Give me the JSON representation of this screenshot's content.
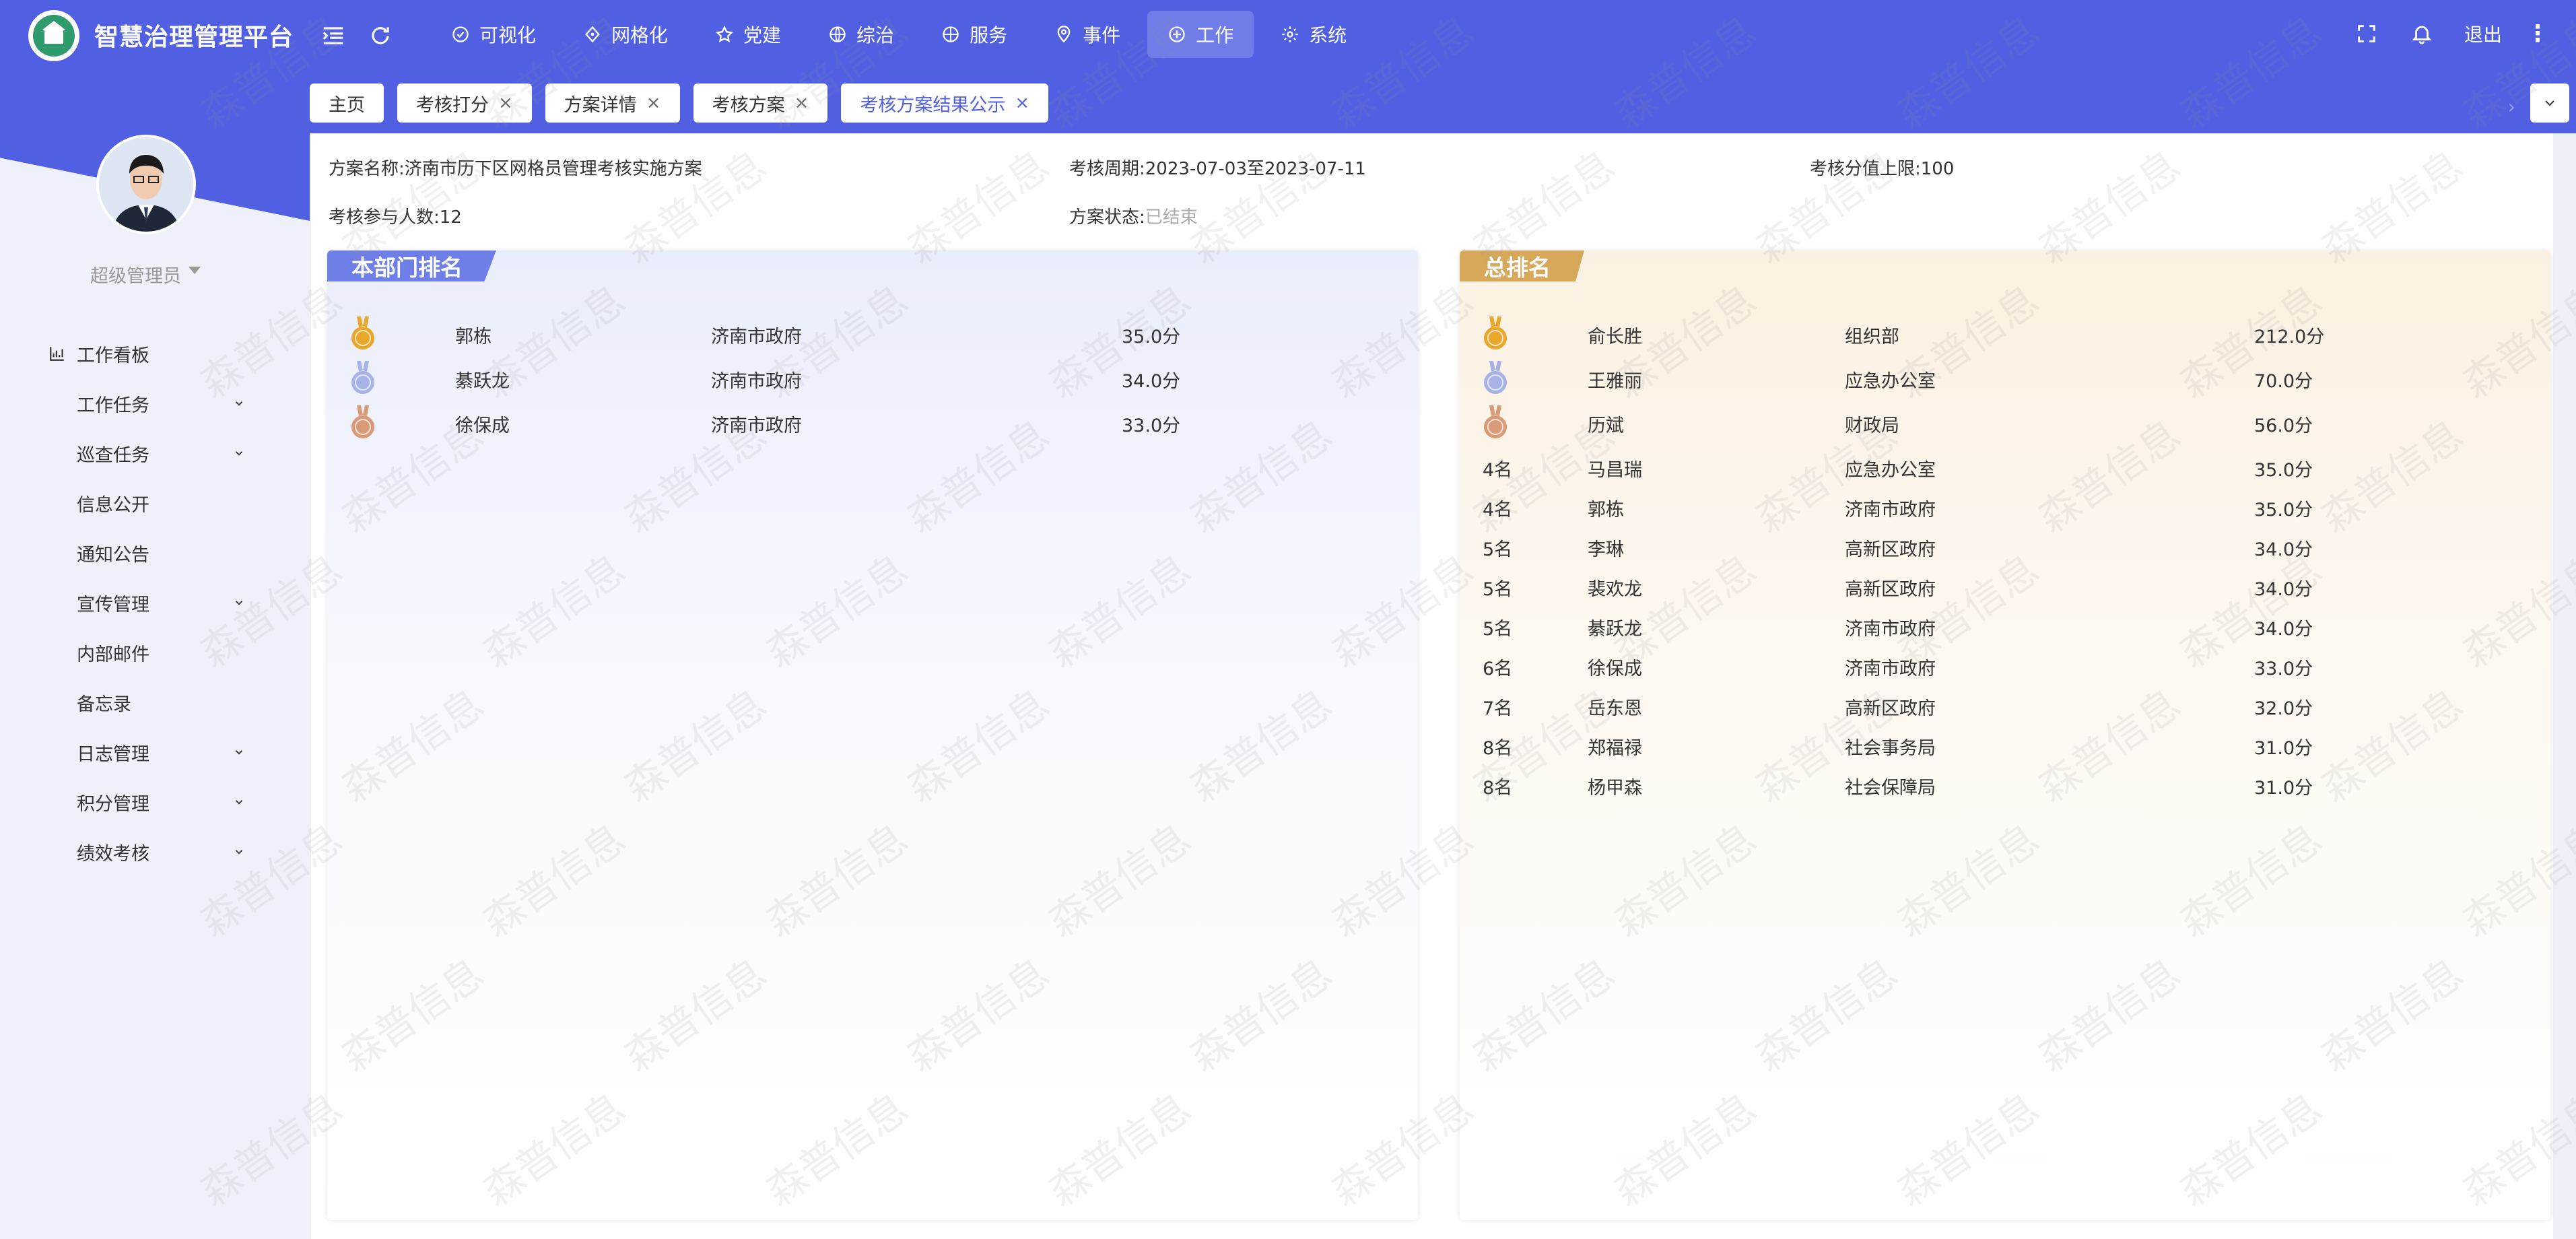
{
  "app": {
    "title": "智慧治理管理平台"
  },
  "nav": {
    "items": [
      {
        "label": "可视化",
        "icon": "visual-icon"
      },
      {
        "label": "网格化",
        "icon": "grid-icon"
      },
      {
        "label": "党建",
        "icon": "star-icon"
      },
      {
        "label": "综治",
        "icon": "globe-icon"
      },
      {
        "label": "服务",
        "icon": "service-icon"
      },
      {
        "label": "事件",
        "icon": "pin-icon"
      },
      {
        "label": "工作",
        "icon": "work-icon",
        "active": true
      },
      {
        "label": "系统",
        "icon": "gear-icon"
      }
    ],
    "logout": "退出"
  },
  "tabs": [
    {
      "label": "主页",
      "closable": false
    },
    {
      "label": "考核打分",
      "closable": true
    },
    {
      "label": "方案详情",
      "closable": true
    },
    {
      "label": "考核方案",
      "closable": true
    },
    {
      "label": "考核方案结果公示",
      "closable": true,
      "active": true
    }
  ],
  "user": {
    "name": "超级管理员"
  },
  "sidebar": {
    "items": [
      {
        "label": "工作看板",
        "icon": "chart-icon",
        "expandable": false
      },
      {
        "label": "工作任务",
        "expandable": true
      },
      {
        "label": "巡查任务",
        "expandable": true
      },
      {
        "label": "信息公开",
        "expandable": false
      },
      {
        "label": "通知公告",
        "expandable": false
      },
      {
        "label": "宣传管理",
        "expandable": true
      },
      {
        "label": "内部邮件",
        "expandable": false
      },
      {
        "label": "备忘录",
        "expandable": false
      },
      {
        "label": "日志管理",
        "expandable": true
      },
      {
        "label": "积分管理",
        "expandable": true
      },
      {
        "label": "绩效考核",
        "expandable": true
      }
    ]
  },
  "plan": {
    "name_label": "方案名称:",
    "name": "济南市历下区网格员管理考核实施方案",
    "period_label": "考核周期:",
    "period": "2023-07-03至2023-07-11",
    "max_label": "考核分值上限:",
    "max": "100",
    "count_label": "考核参与人数:",
    "count": "12",
    "status_label": "方案状态:",
    "status": "已结束"
  },
  "dept_ranking": {
    "title": "本部门排名",
    "rows": [
      {
        "medal": "gold",
        "name": "郭栋",
        "org": "济南市政府",
        "score": "35.0分"
      },
      {
        "medal": "silver",
        "name": "綦跃龙",
        "org": "济南市政府",
        "score": "34.0分"
      },
      {
        "medal": "bronze",
        "name": "徐保成",
        "org": "济南市政府",
        "score": "33.0分"
      }
    ]
  },
  "total_ranking": {
    "title": "总排名",
    "rows": [
      {
        "rank": "",
        "medal": "gold",
        "name": "俞长胜",
        "org": "组织部",
        "score": "212.0分"
      },
      {
        "rank": "",
        "medal": "silver",
        "name": "王雅丽",
        "org": "应急办公室",
        "score": "70.0分"
      },
      {
        "rank": "",
        "medal": "bronze",
        "name": "历斌",
        "org": "财政局",
        "score": "56.0分"
      },
      {
        "rank": "4名",
        "name": "马昌瑞",
        "org": "应急办公室",
        "score": "35.0分"
      },
      {
        "rank": "4名",
        "name": "郭栋",
        "org": "济南市政府",
        "score": "35.0分"
      },
      {
        "rank": "5名",
        "name": "李琳",
        "org": "高新区政府",
        "score": "34.0分"
      },
      {
        "rank": "5名",
        "name": "裴欢龙",
        "org": "高新区政府",
        "score": "34.0分"
      },
      {
        "rank": "5名",
        "name": "綦跃龙",
        "org": "济南市政府",
        "score": "34.0分"
      },
      {
        "rank": "6名",
        "name": "徐保成",
        "org": "济南市政府",
        "score": "33.0分"
      },
      {
        "rank": "7名",
        "name": "岳东恩",
        "org": "高新区政府",
        "score": "32.0分"
      },
      {
        "rank": "8名",
        "name": "郑福禄",
        "org": "社会事务局",
        "score": "31.0分"
      },
      {
        "rank": "8名",
        "name": "杨甲森",
        "org": "社会保障局",
        "score": "31.0分"
      }
    ]
  },
  "watermark": "森普信息",
  "colors": {
    "primary": "#5160e2",
    "gold": "#e9a82b",
    "silver": "#a7b2e6",
    "bronze": "#d99a78",
    "dept_ribbon": "#6f7fe8",
    "total_ribbon": "#d8a85a"
  }
}
